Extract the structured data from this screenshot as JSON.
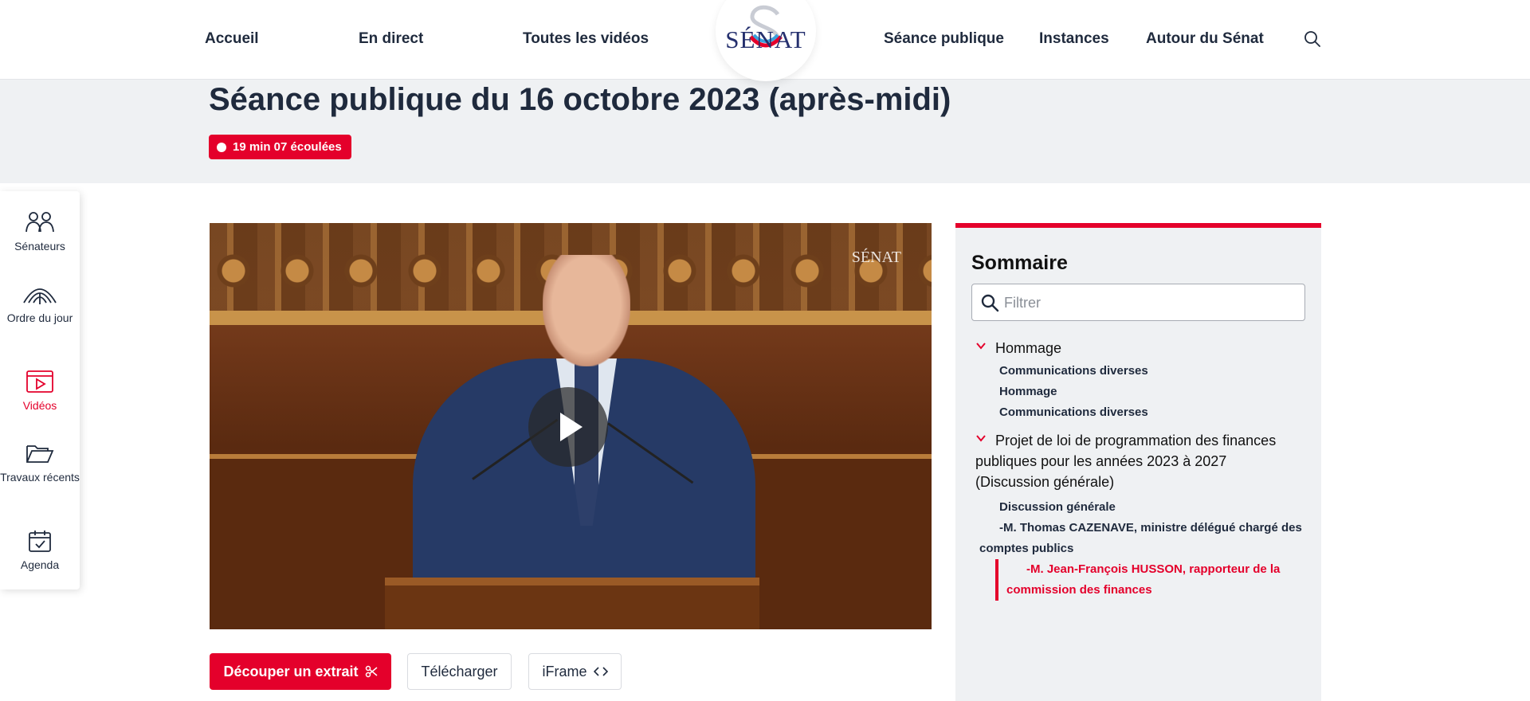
{
  "nav": {
    "items": [
      {
        "label": "Accueil"
      },
      {
        "label": "En direct"
      },
      {
        "label": "Toutes les vidéos"
      },
      {
        "label": "Séance publique"
      },
      {
        "label": "Instances"
      },
      {
        "label": "Autour du Sénat"
      }
    ],
    "logo_text": "SÉNAT",
    "search_icon": "search-icon"
  },
  "header": {
    "title": "Séance publique du 16 octobre 2023 (après-midi)",
    "live_badge": "19 min 07 écoulées"
  },
  "side_rail": {
    "items": [
      {
        "label": "Sénateurs",
        "icon": "senators-icon"
      },
      {
        "label": "Ordre du jour",
        "icon": "broadcast-icon"
      },
      {
        "label": "Vidéos",
        "icon": "video-icon",
        "active": true
      },
      {
        "label": "Travaux récents",
        "icon": "folder-icon"
      },
      {
        "label": "Agenda",
        "icon": "calendar-icon"
      }
    ]
  },
  "video": {
    "watermark": "SÉNAT",
    "play_icon": "play-icon"
  },
  "actions": {
    "cut_label": "Découper un extrait",
    "download_label": "Télécharger",
    "iframe_label": "iFrame"
  },
  "sommaire": {
    "title": "Sommaire",
    "filter_placeholder": "Filtrer",
    "sections": [
      {
        "title": "Hommage",
        "items": [
          "Communications diverses",
          "Hommage",
          "Communications diverses"
        ]
      },
      {
        "title": "Projet de loi de programmation des finances publiques pour les années 2023 à 2027 (Discussion générale)",
        "items": [
          "Discussion générale",
          "-M. Thomas CAZENAVE, ministre délégué chargé des comptes publics",
          "-M. Jean-François HUSSON, rapporteur de la commission des finances"
        ]
      }
    ]
  },
  "colors": {
    "accent": "#e4002b",
    "text": "#1f2a3d",
    "band": "#eff1f3"
  }
}
